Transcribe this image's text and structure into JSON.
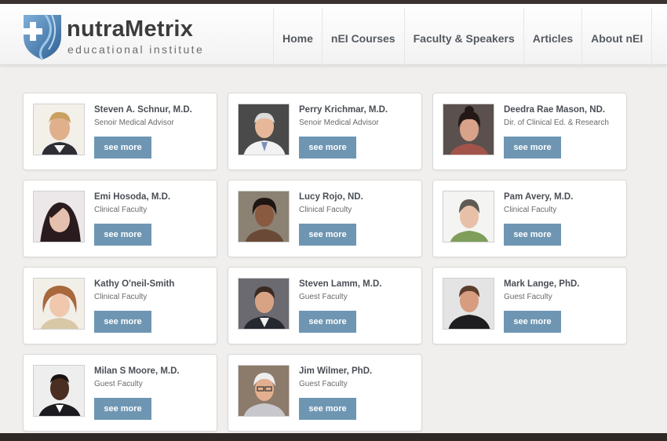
{
  "header": {
    "logo": {
      "name": "nutraMetrix",
      "tagline": "educational institute"
    },
    "nav": [
      {
        "label": "Home"
      },
      {
        "label": "nEI Courses"
      },
      {
        "label": "Faculty & Speakers"
      },
      {
        "label": "Articles"
      },
      {
        "label": "About nEI"
      }
    ]
  },
  "people": [
    {
      "name": "Steven A. Schnur, M.D.",
      "role": "Senoir Medical Advisor",
      "button": "see more"
    },
    {
      "name": "Perry Krichmar, M.D.",
      "role": "Senoir Medical Advisor",
      "button": "see more"
    },
    {
      "name": "Deedra Rae Mason, ND.",
      "role": "Dir. of Clinical Ed. & Research",
      "button": "see more"
    },
    {
      "name": "Emi Hosoda, M.D.",
      "role": "Clinical Faculty",
      "button": "see more"
    },
    {
      "name": "Lucy Rojo, ND.",
      "role": "Clinical Faculty",
      "button": "see more"
    },
    {
      "name": "Pam Avery, M.D.",
      "role": "Clinical Faculty",
      "button": "see more"
    },
    {
      "name": "Kathy O'neil-Smith",
      "role": "Clinical Faculty",
      "button": "see more"
    },
    {
      "name": "Steven Lamm, M.D.",
      "role": "Guest Faculty",
      "button": "see more"
    },
    {
      "name": "Mark Lange, PhD.",
      "role": "Guest Faculty",
      "button": "see more"
    },
    {
      "name": "Milan S Moore, M.D.",
      "role": "Guest Faculty",
      "button": "see more"
    },
    {
      "name": "Jim Wilmer, PhD.",
      "role": "Guest Faculty",
      "button": "see more"
    }
  ],
  "colors": {
    "button": "#6e96b3",
    "logo_shield": "#4a7fb5",
    "page_background": "#f1efed"
  }
}
